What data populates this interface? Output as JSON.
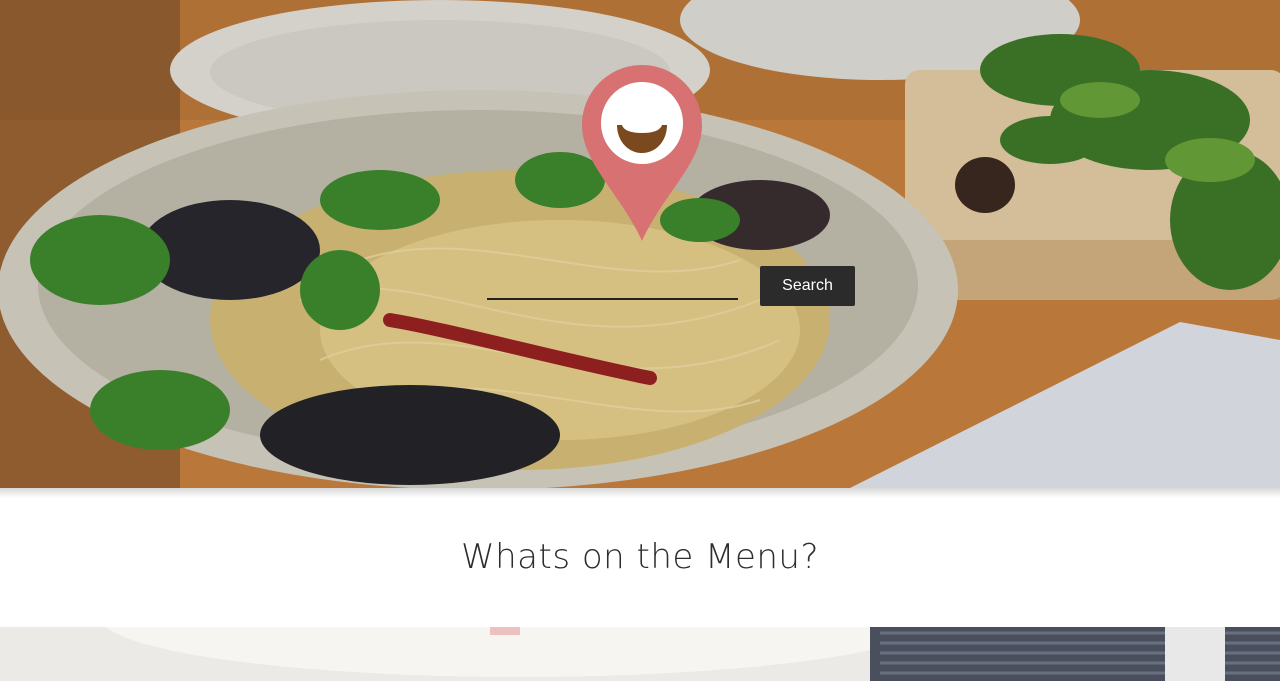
{
  "hero": {
    "search": {
      "value": "",
      "placeholder": "",
      "button_label": "Search"
    },
    "logo_icon": "map-pin-bowl-icon",
    "pin_color": "#d87272",
    "bowl_color": "#7a4a1e"
  },
  "section": {
    "title": "Whats on the Menu?"
  }
}
